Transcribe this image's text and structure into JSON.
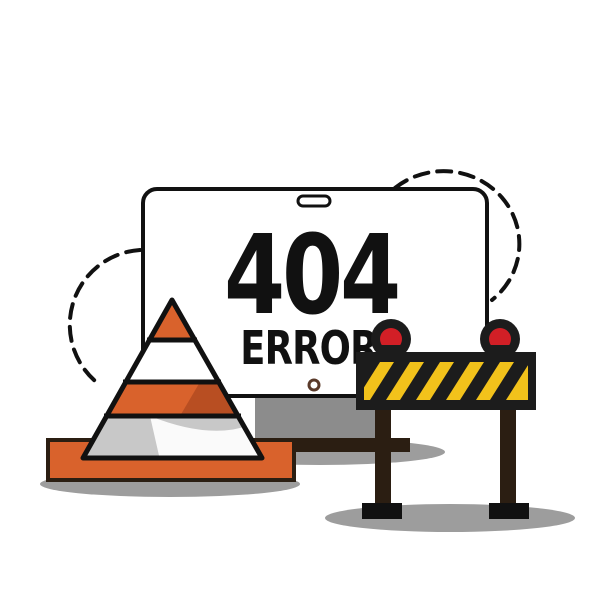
{
  "illustration": {
    "code": "404",
    "label": "ERROR"
  },
  "icons": {
    "monitor": "monitor-icon",
    "cone": "traffic-cone-icon",
    "barrier": "road-barrier-icon"
  },
  "colors": {
    "outline": "#111111",
    "cone_orange": "#d9622c",
    "cone_orange_dark": "#b84e22",
    "cone_white": "#ffffff",
    "cone_grey": "#c8c8c8",
    "barrier_yellow": "#f2c21b",
    "barrier_black": "#1c1c1c",
    "warning_light": "#d21f26",
    "post_brown": "#2b1e12",
    "shadow": "#8c8c8c",
    "monitor_fill": "#ffffff"
  }
}
